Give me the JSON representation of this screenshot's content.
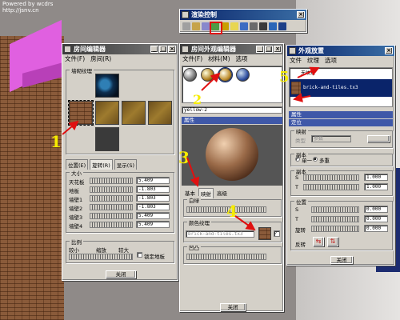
{
  "watermark": "Powered by wcdrs\nhttp://jsnv.cn",
  "render_toolbar": {
    "title": "渲染控制",
    "tools": [
      {
        "icon": "pointer-icon",
        "color": "#a0a0a0"
      },
      {
        "icon": "grid-icon",
        "color": "#c6a34b"
      },
      {
        "icon": "image-icon",
        "color": "#8888cc"
      },
      {
        "icon": "texture-icon",
        "color": "#4f9c45"
      },
      {
        "icon": "wand-icon",
        "color": "#c8a000"
      },
      {
        "icon": "bulb-icon",
        "color": "#e8d650"
      },
      {
        "icon": "sphere-icon",
        "color": "#3c6cc2"
      },
      {
        "icon": "cube-icon",
        "color": "#6a6a6a"
      },
      {
        "icon": "camera-icon",
        "color": "#3a3a3a"
      },
      {
        "icon": "monitor-icon",
        "color": "#2a66b8"
      },
      {
        "icon": "monitor2-icon",
        "color": "#1d3f88"
      }
    ]
  },
  "room_editor": {
    "title": "房间编辑器",
    "menu": [
      "文件(F)",
      "房间(R)"
    ],
    "texture_group_label": "墙砌纹理",
    "tabs": [
      "位置(E)",
      "旋转(R)",
      "显示(S)"
    ],
    "size_group_label": "大小",
    "size_rows": [
      {
        "label": "天花板",
        "value": "5.409"
      },
      {
        "label": "地板",
        "value": "-1.803"
      },
      {
        "label": "墙壁1",
        "value": "-1.803"
      },
      {
        "label": "墙壁2",
        "value": "-1.803"
      },
      {
        "label": "墙壁3",
        "value": "5.409"
      },
      {
        "label": "墙壁4",
        "value": "5.409"
      }
    ],
    "ratio_group_label": "比例",
    "ratio_labels": [
      "较小",
      "缩放",
      "较大"
    ],
    "lock_label": "锁定地板",
    "close_label": "关闭"
  },
  "material_editor": {
    "title": "房间外观编辑器",
    "menu": [
      "文件(F)",
      "材料(M)",
      "选项"
    ],
    "material_name": "yellow-2",
    "properties_label": "属性",
    "tabs": [
      "基本",
      "映射",
      "高级"
    ],
    "white_label": "白绿",
    "color_texture_label": "颜色纹理",
    "texture_file": "brick-and-tiles.tx3",
    "bump_label": "凹凸",
    "close_label": "关闭"
  },
  "appearance_placement": {
    "title": "外观放置",
    "menu": [
      "文件",
      "纹理",
      "选项"
    ],
    "list_items": [
      "无纹理",
      "brick-and-tiles.tx3"
    ],
    "section_properties": "属性",
    "section_placement": "定位",
    "mapping_label": "映射",
    "mapping_type_label": "类型",
    "mapping_type_value": "参数",
    "copies_label": "副本",
    "copies_options": [
      "单一",
      "多重"
    ],
    "copies_row_label": "副本",
    "copies_s": {
      "label": "S",
      "value": "1.000"
    },
    "copies_t": {
      "label": "T",
      "value": "1.000"
    },
    "position_label": "位置",
    "position_rows": [
      {
        "label": "S",
        "value": "0.000"
      },
      {
        "label": "T",
        "value": "0.000"
      },
      {
        "label": "旋转",
        "value": "0.000"
      }
    ],
    "flip_label": "反转",
    "close_label": "关闭"
  },
  "annotations": [
    "1",
    "2",
    "3",
    "4",
    "5"
  ],
  "colors": {
    "annotation": "#f6ec00",
    "arrow": "#e01010",
    "selection": "#0a246a"
  }
}
